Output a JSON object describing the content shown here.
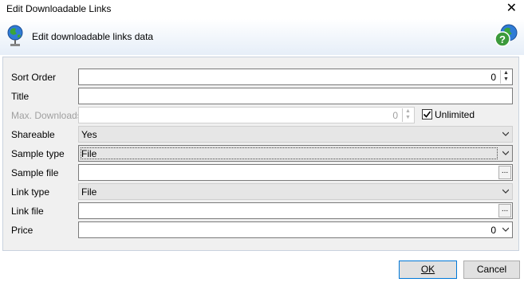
{
  "window": {
    "title": "Edit Downloadable Links"
  },
  "header": {
    "subtitle": "Edit downloadable links data"
  },
  "form": {
    "sort_order": {
      "label": "Sort Order",
      "value": "0"
    },
    "title": {
      "label": "Title",
      "value": ""
    },
    "max_downloads": {
      "label": "Max. Downloads",
      "value": "0",
      "unlimited_label": "Unlimited",
      "unlimited_checked": true
    },
    "shareable": {
      "label": "Shareable",
      "value": "Yes"
    },
    "sample_type": {
      "label": "Sample type",
      "value": "File"
    },
    "sample_file": {
      "label": "Sample file",
      "value": "",
      "browse": "..."
    },
    "link_type": {
      "label": "Link type",
      "value": "File"
    },
    "link_file": {
      "label": "Link file",
      "value": "",
      "browse": "..."
    },
    "price": {
      "label": "Price",
      "value": "0"
    }
  },
  "buttons": {
    "ok": "OK",
    "cancel": "Cancel"
  },
  "icons": {
    "close": "close-icon",
    "globe": "globe-icon",
    "help": "help-globe-icon"
  }
}
